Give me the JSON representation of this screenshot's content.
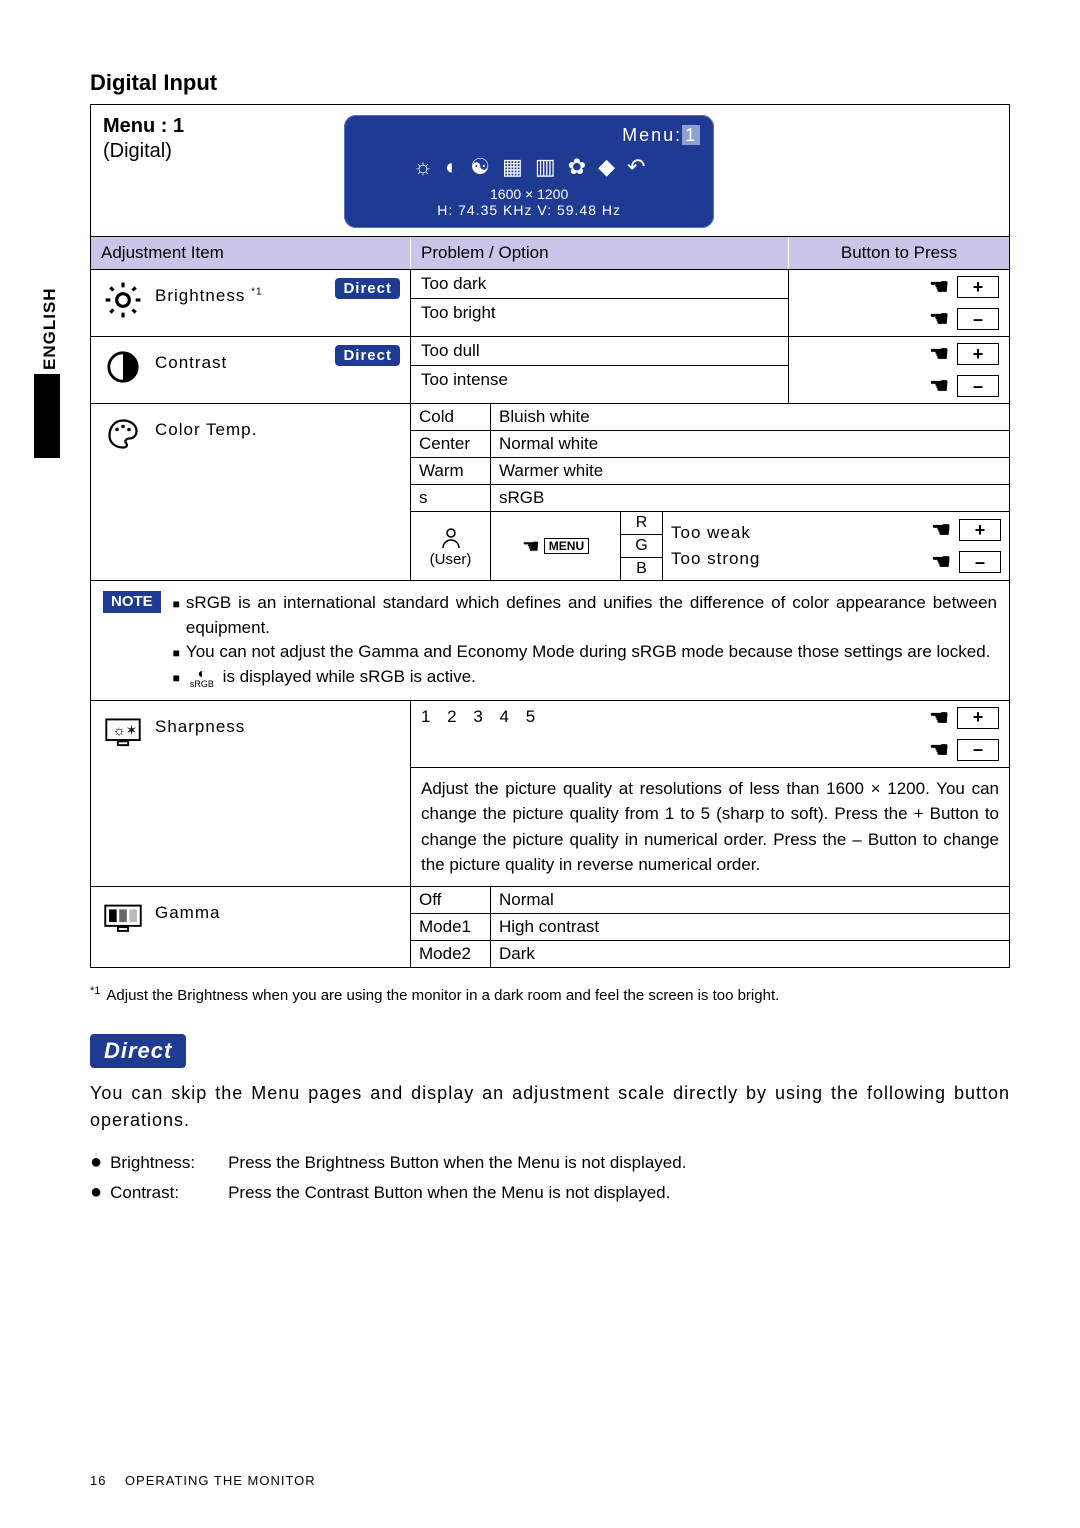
{
  "sideTab": "ENGLISH",
  "sectionTitle": "Digital Input",
  "menu": {
    "label": "Menu : 1",
    "sub": "(Digital)"
  },
  "osd": {
    "title": "Menu:",
    "titleNum": "1",
    "resolution": "1600 × 1200",
    "freq": "H: 74.35 KHz  V: 59.48 Hz"
  },
  "headers": {
    "adj": "Adjustment Item",
    "prob": "Problem / Option",
    "btn": "Button to Press"
  },
  "brightness": {
    "label": "Brightness",
    "sup": "*1",
    "badge": "Direct",
    "opt1": "Too dark",
    "opt2": "Too bright"
  },
  "contrast": {
    "label": "Contrast",
    "badge": "Direct",
    "opt1": "Too dull",
    "opt2": "Too intense"
  },
  "colorTemp": {
    "label": "Color Temp.",
    "rows": [
      {
        "l": "Cold",
        "r": "Bluish white"
      },
      {
        "l": "Center",
        "r": "Normal white"
      },
      {
        "l": "Warm",
        "r": "Warmer white"
      },
      {
        "l": "s",
        "r": "sRGB"
      }
    ],
    "user": {
      "label": "(User)",
      "channels": [
        "R",
        "G",
        "B"
      ],
      "weak": "Too weak",
      "strong": "Too strong",
      "menuBtn": "MENU"
    }
  },
  "note": {
    "badge": "NOTE",
    "b1": "sRGB is an international standard which defines and unifies the difference of color appearance between equipment.",
    "b2": "You can not adjust the Gamma and Economy Mode during sRGB mode because those settings are locked.",
    "b3a": "",
    "b3b": " is displayed while sRGB is active.",
    "srgbIconLabel": "sRGB"
  },
  "sharpness": {
    "label": "Sharpness",
    "levels": "1 2 3 4 5",
    "desc": "Adjust the picture quality at resolutions of less than 1600 × 1200. You can change the picture quality from 1 to 5 (sharp to soft). Press the + Button to change the picture quality in numerical order. Press the – Button to change the picture quality in reverse numerical order."
  },
  "gamma": {
    "label": "Gamma",
    "rows": [
      {
        "l": "Off",
        "r": "Normal"
      },
      {
        "l": "Mode1",
        "r": "High contrast"
      },
      {
        "l": "Mode2",
        "r": "Dark"
      }
    ]
  },
  "footnote": {
    "star": "*1",
    "text": "Adjust the Brightness when you are using the monitor in a dark room and feel the screen is too bright."
  },
  "directSection": {
    "heading": "Direct",
    "intro": "You can skip the Menu pages and display an adjustment scale directly by using the following button operations.",
    "items": [
      {
        "label": "Brightness:",
        "text": "Press the Brightness Button when the Menu is not displayed."
      },
      {
        "label": "Contrast:",
        "text": "Press the Contrast Button when the Menu is not displayed."
      }
    ]
  },
  "footer": {
    "page": "16",
    "text": "OPERATING THE MONITOR"
  },
  "buttons": {
    "plus": "+",
    "minus": "–"
  }
}
